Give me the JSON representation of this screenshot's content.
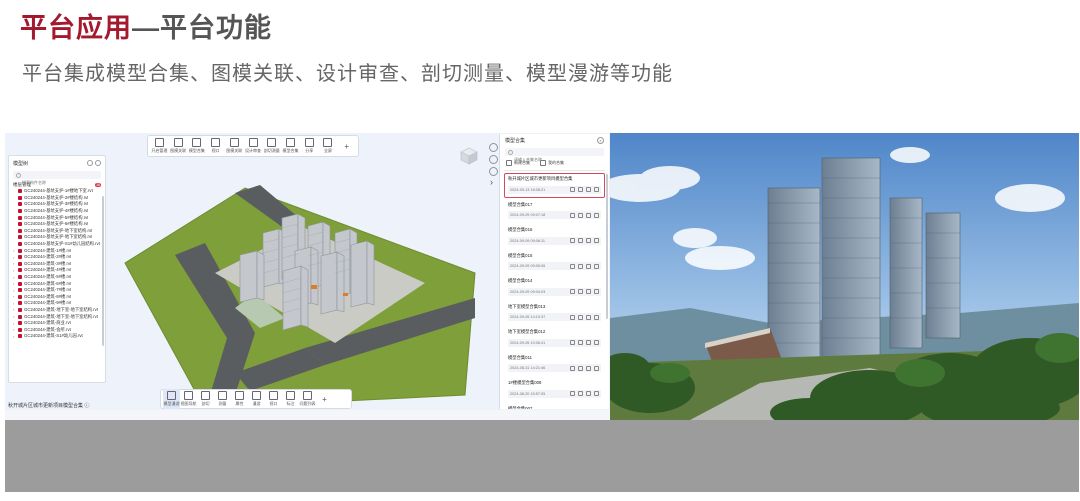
{
  "slide": {
    "title_accent": "平台应用",
    "title_rest": "—平台功能",
    "subtitle": "平台集成模型合集、图模关联、设计审查、剖切测量、模型漫游等功能"
  },
  "top_toolbar": [
    {
      "label": "开启管理",
      "icon": "folder-icon"
    },
    {
      "label": "图模关联",
      "icon": "file-link-icon"
    },
    {
      "label": "模型合集",
      "icon": "model-stack-icon"
    },
    {
      "label": "视口",
      "icon": "viewport-icon"
    },
    {
      "label": "图模关联",
      "icon": "link-icon"
    },
    {
      "label": "设计审查",
      "icon": "review-icon"
    },
    {
      "label": "剖切测量",
      "icon": "section-icon"
    },
    {
      "label": "模型合集",
      "icon": "cube-icon"
    },
    {
      "label": "分享",
      "icon": "share-icon"
    },
    {
      "label": "全屏",
      "icon": "fullscreen-icon"
    },
    {
      "label": "",
      "icon": "plus-icon"
    }
  ],
  "bottom_toolbar": [
    {
      "label": "模型漫游",
      "icon": "walk-icon"
    },
    {
      "label": "视图导航",
      "icon": "nav-icon"
    },
    {
      "label": "剖切",
      "icon": "section-icon"
    },
    {
      "label": "测量",
      "icon": "measure-icon"
    },
    {
      "label": "属性",
      "icon": "properties-icon"
    },
    {
      "label": "漫游",
      "icon": "roam-icon"
    },
    {
      "label": "视口",
      "icon": "viewport-icon"
    },
    {
      "label": "标注",
      "icon": "tag-icon"
    },
    {
      "label": "问题列表",
      "icon": "issue-icon"
    },
    {
      "label": "",
      "icon": "plus-icon"
    }
  ],
  "model_tree": {
    "title": "模型树",
    "search_placeholder": "搜索构件名称",
    "group": "楼层管理",
    "badge": "16",
    "items": [
      "GC240244-基坑支护-1#楼地下室.rvt",
      "GC240244-基坑支护-2#楼结构.rvt",
      "GC240244-基坑支护-3#楼结构.rvt",
      "GC240244-基坑支护-4#楼结构.rvt",
      "GC240244-基坑支护-5#楼结构.rvt",
      "GC240244-基坑支护-6#楼结构.rvt",
      "GC240244-基坑支护-地下室结构.rvt",
      "GC240244-基坑支护-地下室结构.rvt",
      "GC240244-基坑支护-S1#幼儿园结构.rvt",
      "GC240244-建筑-1#楼.rvt",
      "GC240244-建筑-2#楼.rvt",
      "GC240244-建筑-3#楼.rvt",
      "GC240244-建筑-4#楼.rvt",
      "GC240244-建筑-5#楼.rvt",
      "GC240244-建筑-6#楼.rvt",
      "GC240244-建筑-7#楼.rvt",
      "GC240244-建筑-8#楼.rvt",
      "GC240244-建筑-9#楼.rvt",
      "GC240244-建筑-地下室-地下室结构.rvt",
      "GC240244-建筑-地下室-地下室结构.rvt",
      "GC240244-建筑-商业.rvt",
      "GC240244-建筑-会所.rvt",
      "GC240244-建筑-S1#幼儿园.rvt"
    ]
  },
  "federation": {
    "title": "模型合集",
    "search_placeholder": "请输入合集名称",
    "action_new": "新建合集",
    "action_mine": "我的合集",
    "items": [
      {
        "name": "秋开城片区城市更新项目模型合集",
        "date": "2024-09-13 16:08:21"
      },
      {
        "name": "模型合集017",
        "date": "2024-09-09 09:07:18"
      },
      {
        "name": "模型合集016",
        "date": "2024-09-09 09:06:11"
      },
      {
        "name": "模型合集015",
        "date": "2024-09-09 09:05:06"
      },
      {
        "name": "模型合集014",
        "date": "2024-09-09 09:04:03"
      },
      {
        "name": "地下室模型合集013",
        "date": "2024-09-05 14:10:37"
      },
      {
        "name": "地下室模型合集012",
        "date": "2024-09-05 10:06:41"
      },
      {
        "name": "模型合集011",
        "date": "2024-08-31 14:21:46"
      },
      {
        "name": "1#楼模型合集008",
        "date": "2024-08-20 15:57:05"
      },
      {
        "name": "模型合集007",
        "date": ""
      }
    ]
  },
  "status": {
    "project": "秋开城片区城市更新项目模型合集",
    "info_icon": "info-icon"
  },
  "colors": {
    "accent": "#a3192d",
    "checkbox": "#c8102e",
    "selected_border": "#d9485b",
    "band": "#9c9c9c"
  }
}
